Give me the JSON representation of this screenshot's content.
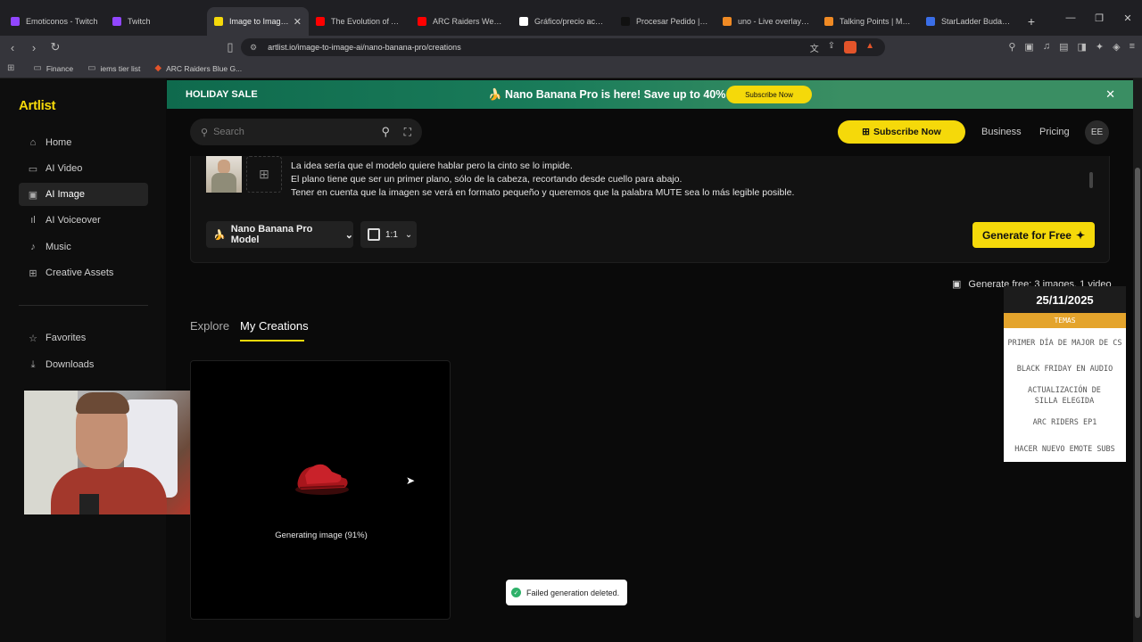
{
  "browser": {
    "tabs": [
      {
        "title": "Emoticonos - Twitch",
        "color": "#9146ff"
      },
      {
        "title": "Twitch",
        "color": "#9146ff"
      },
      {
        "title": "Image to Image AI",
        "color": "#f5d90a"
      },
      {
        "title": "The Evolution of ARC R",
        "color": "#ff0000"
      },
      {
        "title": "ARC Raiders Weapon T",
        "color": "#ff0000"
      },
      {
        "title": "Gráfico/precio acciones",
        "color": "#ffffff"
      },
      {
        "title": "Procesar Pedido | Mue",
        "color": "#111111"
      },
      {
        "title": "uno - Live overlays for",
        "color": "#f08a24"
      },
      {
        "title": "Talking Points | Mome",
        "color": "#f08a24"
      },
      {
        "title": "StarLadder Budapest M",
        "color": "#3a6ee8"
      }
    ],
    "url": "artlist.io/image-to-image-ai/nano-banana-pro/creations",
    "bookmarks": [
      "Finance",
      "iems tier list",
      "ARC Raiders Blue G..."
    ]
  },
  "sidebar": {
    "logo": "Artlist",
    "items": [
      {
        "label": "Home",
        "icon": "home-icon"
      },
      {
        "label": "AI Video",
        "icon": "video-icon"
      },
      {
        "label": "AI Image",
        "icon": "image-icon"
      },
      {
        "label": "AI Voiceover",
        "icon": "waveform-icon"
      },
      {
        "label": "Music",
        "icon": "music-icon"
      },
      {
        "label": "Creative Assets",
        "icon": "grid-icon"
      },
      {
        "label": "Favorites",
        "icon": "star-icon"
      },
      {
        "label": "Downloads",
        "icon": "download-icon"
      }
    ]
  },
  "banner": {
    "sale": "HOLIDAY SALE",
    "promo": "🍌 Nano Banana Pro is here! Save up to 40%",
    "button": "Subscribe Now"
  },
  "header": {
    "search_placeholder": "Search",
    "subscribe": "Subscribe Now",
    "business": "Business",
    "pricing": "Pricing",
    "avatar": "EE"
  },
  "prompt": {
    "lines": [
      "La idea sería que el modelo quiere hablar pero la cinto se lo impide.",
      "El plano tiene que ser un primer plano, sólo de la cabeza, recortando desde cuello para abajo.",
      "Tener en cuenta que la imagen se verá en formato pequeño y queremos que la palabra MUTE sea lo más legible posible."
    ],
    "model": "Nano Banana Pro Model",
    "ratio": "1:1",
    "generate": "Generate for Free",
    "free_note": "Generate free: 3 images, 1 video"
  },
  "tabs": {
    "explore": "Explore",
    "mine": "My Creations"
  },
  "creation": {
    "status": "Generating image (91%)",
    "progress": 0.91
  },
  "toast": "Failed generation deleted.",
  "overlay": {
    "date": "25/11/2025",
    "header": "TEMAS",
    "items": [
      "Primer día de Major de CS",
      "Black Friday en audio",
      "Actualización de silla elegida",
      "ARC Riders EP1",
      "Hacer nuevo emote subs"
    ]
  },
  "colors": {
    "accent": "#f5d90a",
    "banner": "#1a7c5a"
  }
}
